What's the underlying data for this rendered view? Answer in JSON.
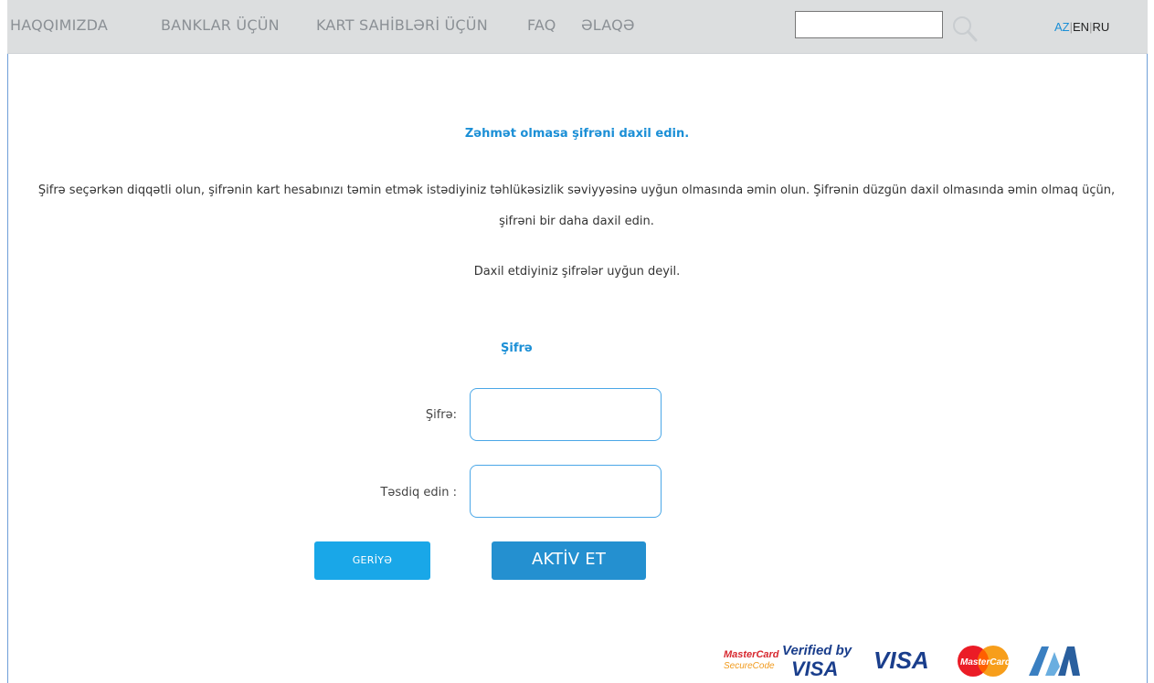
{
  "nav": {
    "items": [
      "HAQQIMIZDA",
      "BANKLAR ÜÇÜN",
      "KART SAHİBLƏRİ ÜÇÜN",
      "FAQ",
      "ƏLAQƏ"
    ],
    "search": {
      "value": "",
      "icon": "search-icon"
    },
    "languages": {
      "az": "AZ",
      "en": "EN",
      "ru": "RU",
      "separator": "|",
      "active": "AZ"
    }
  },
  "main": {
    "heading": "Zəhmət olmasa şifrəni daxil edin.",
    "info": "Şifrə seçərkən diqqətli olun, şifrənin kart hesabınızı təmin etmək istədiyiniz təhlükəsizlik səviyyəsinə uyğun olmasında əmin olun. Şifrənin düzgün daxil olmasında əmin olmaq üçün, şifrəni bir daha daxil edin.",
    "error": "Daxil etdiyiniz şifrələr uyğun deyil.",
    "section_title": "Şifrə",
    "fields": {
      "password_label": "Şifrə:",
      "password_value": "",
      "confirm_label": "Təsdiq edin :",
      "confirm_value": ""
    },
    "buttons": {
      "back": "GERİYƏ",
      "activate": "AKTİV ET"
    }
  },
  "footer": {
    "logos": {
      "mastercard_securecode": [
        "MasterCard",
        "SecureCode"
      ],
      "verified_by_visa": [
        "Verified by",
        "VISA"
      ],
      "visa": "VISA",
      "mastercard": "MasterCard"
    }
  },
  "colors": {
    "accent": "#1b8fd6",
    "topbar": "#dcdedf",
    "button_back": "#19a7e8",
    "button_activate": "#2490d0"
  }
}
